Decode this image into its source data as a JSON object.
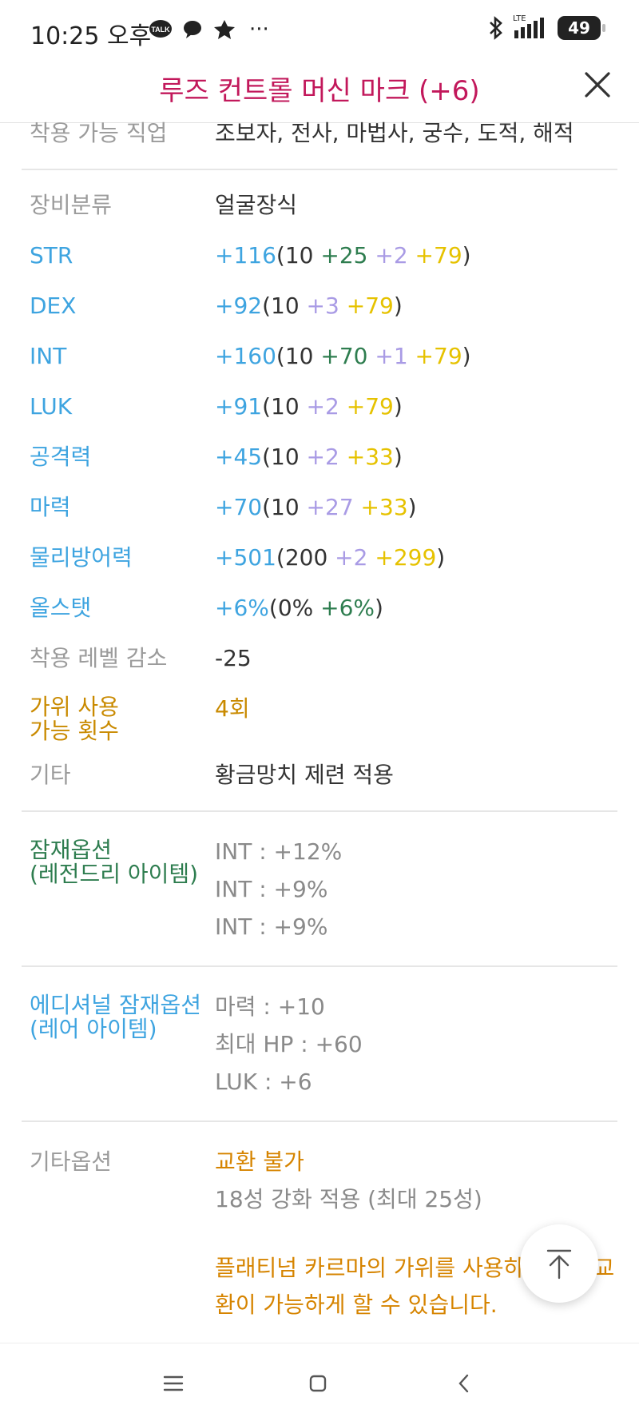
{
  "status_bar": {
    "time": "10:25 오후",
    "kakao_badge": "TALK",
    "more": "···",
    "network": "LTE",
    "battery": "49"
  },
  "header": {
    "title": "루즈 컨트롤 머신 마크 (+6)"
  },
  "rows": {
    "jobs": {
      "label": "착용 가능 직업",
      "value": "조보자, 전사, 마법사, 궁수, 도적, 해적"
    },
    "category": {
      "label": "장비분류",
      "value": "얼굴장식"
    },
    "str": {
      "label": "STR",
      "total": "+116",
      "open": "(10",
      "a": " +25",
      "b": " +2",
      "c": " +79",
      "close": ")"
    },
    "dex": {
      "label": "DEX",
      "total": "+92",
      "open": "(10",
      "b": " +3",
      "c": " +79",
      "close": ")"
    },
    "int": {
      "label": "INT",
      "total": "+160",
      "open": "(10",
      "a": " +70",
      "b": " +1",
      "c": " +79",
      "close": ")"
    },
    "luk": {
      "label": "LUK",
      "total": "+91",
      "open": "(10",
      "b": " +2",
      "c": " +79",
      "close": ")"
    },
    "atk": {
      "label": "공격력",
      "total": "+45",
      "open": "(10",
      "b": " +2",
      "c": " +33",
      "close": ")"
    },
    "matk": {
      "label": "마력",
      "total": "+70",
      "open": "(10",
      "b": " +27",
      "c": " +33",
      "close": ")"
    },
    "def": {
      "label": "물리방어력",
      "total": "+501",
      "open": "(200",
      "b": " +2",
      "c": " +299",
      "close": ")"
    },
    "allstat": {
      "label": "올스탯",
      "total": "+6%",
      "open": "(0%",
      "a": " +6%",
      "close": ")"
    },
    "req_level": {
      "label": "착용 레벨 감소",
      "value": "-25"
    },
    "scissors": {
      "label_line1": "가위 사용",
      "label_line2": "가능 횟수",
      "value": "4회"
    },
    "etc": {
      "label": "기타",
      "value": "황금망치 제련 적용"
    }
  },
  "potential": {
    "label_line1": "잠재옵션",
    "label_line2": "(레전드리 아이템)",
    "lines": [
      "INT : +12%",
      "INT : +9%",
      "INT : +9%"
    ]
  },
  "additional": {
    "label_line1": "에디셔널 잠재옵션",
    "label_line2": "(레어 아이템)",
    "lines": [
      "마력 : +10",
      "최대 HP : +60",
      "LUK : +6"
    ]
  },
  "other_options": {
    "label": "기타옵션",
    "trade": "교환 불가",
    "starforce": "18성 강화 적용 (최대 25성)",
    "note": "플래티넘 카르마의 가위를 사용하면 1회 교환이 가능하게 할 수 있습니다."
  },
  "colors": {
    "title": "#c2185b",
    "stat_label": "#3ea4e0",
    "base": "#333333",
    "upgrade_green": "#2e7d4f",
    "star_lavender": "#a99be5",
    "bonus_yellow": "#e6c200",
    "scissors_gold": "#c98a00",
    "potential_green": "#2e7d4f"
  }
}
